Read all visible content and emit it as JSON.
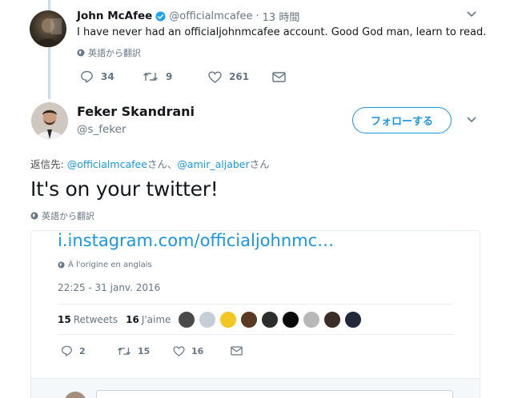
{
  "tweet1": {
    "name": "John McAfee",
    "handle": "@officialmcafee",
    "separator": "·",
    "time": "13 時間",
    "text": "I have never had an officialjohnmcafee account. Good God man, learn to read.",
    "translate": "英語から翻訳",
    "replies": "34",
    "retweets": "9",
    "likes": "261"
  },
  "tweet2": {
    "name": "Feker Skandrani",
    "handle": "@s_feker",
    "follow_label": "フォローする",
    "reply_prefix": "返信先: ",
    "reply_user1": "@officialmcafee",
    "reply_suffix1": "さん、",
    "reply_user2": "@amir_aljaber",
    "reply_suffix2": "さん",
    "text": "It's on your twitter!",
    "translate": "英語から翻訳"
  },
  "embedded": {
    "link": "i.instagram.com/officialjohnmc…",
    "origin": "À l'origine en anglais",
    "timestamp": "22:25 - 31 janv. 2016",
    "retweets_count": "15",
    "retweets_label": "Retweets",
    "likes_count": "16",
    "likes_label": "J'aime",
    "replies": "2",
    "retweets": "15",
    "likes": "16"
  },
  "colors": {
    "accent": "#1b95e0",
    "thread_line": "#c4dff5",
    "muted": "#657786"
  }
}
